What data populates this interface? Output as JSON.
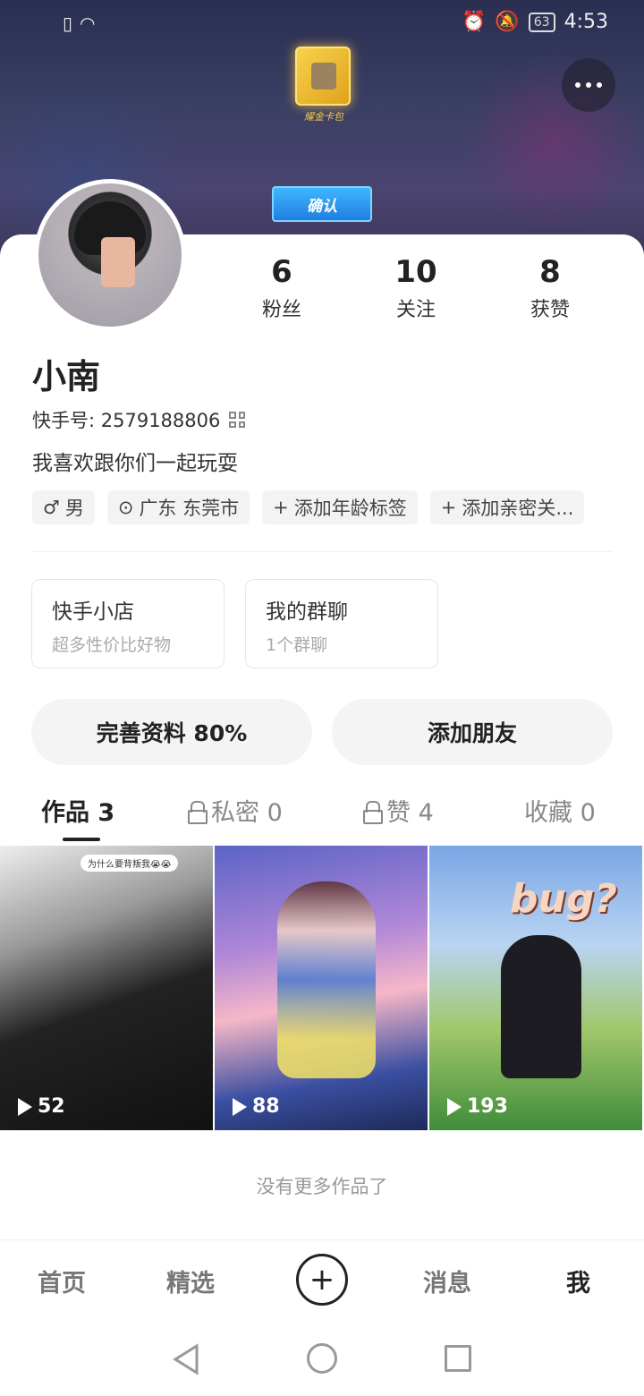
{
  "status_bar": {
    "time": "4:53",
    "battery": "63"
  },
  "banner": {
    "card_pack_label": "耀金卡包",
    "confirm_label": "确认"
  },
  "profile": {
    "name": "小南",
    "kuaishou_id": "快手号: 2579188806",
    "bio": "我喜欢跟你们一起玩耍",
    "stats": [
      {
        "num": "6",
        "label": "粉丝"
      },
      {
        "num": "10",
        "label": "关注"
      },
      {
        "num": "8",
        "label": "获赞"
      }
    ],
    "tags": [
      {
        "icon": "male-icon",
        "label": "男"
      },
      {
        "icon": "location-icon",
        "label": "广东 东莞市"
      },
      {
        "icon": "plus-icon",
        "label": "添加年龄标签"
      },
      {
        "icon": "plus-icon",
        "label": "添加亲密关..."
      }
    ],
    "cards": [
      {
        "title": "快手小店",
        "subtitle": "超多性价比好物"
      },
      {
        "title": "我的群聊",
        "subtitle": "1个群聊"
      }
    ],
    "actions": {
      "complete_profile": "完善资料 80%",
      "add_friend": "添加朋友"
    }
  },
  "tabs": [
    {
      "label": "作品 3",
      "locked": false
    },
    {
      "label": "私密 0",
      "locked": true
    },
    {
      "label": "赞 4",
      "locked": true
    },
    {
      "label": "收藏 0",
      "locked": false
    }
  ],
  "videos": [
    {
      "plays": "52",
      "caption": "为什么要背叛我😭😭"
    },
    {
      "plays": "88",
      "caption": ""
    },
    {
      "plays": "193",
      "caption": "bug?"
    }
  ],
  "no_more": "没有更多作品了",
  "bottom_nav": {
    "home": "首页",
    "featured": "精选",
    "messages": "消息",
    "me": "我",
    "plus": "+"
  }
}
